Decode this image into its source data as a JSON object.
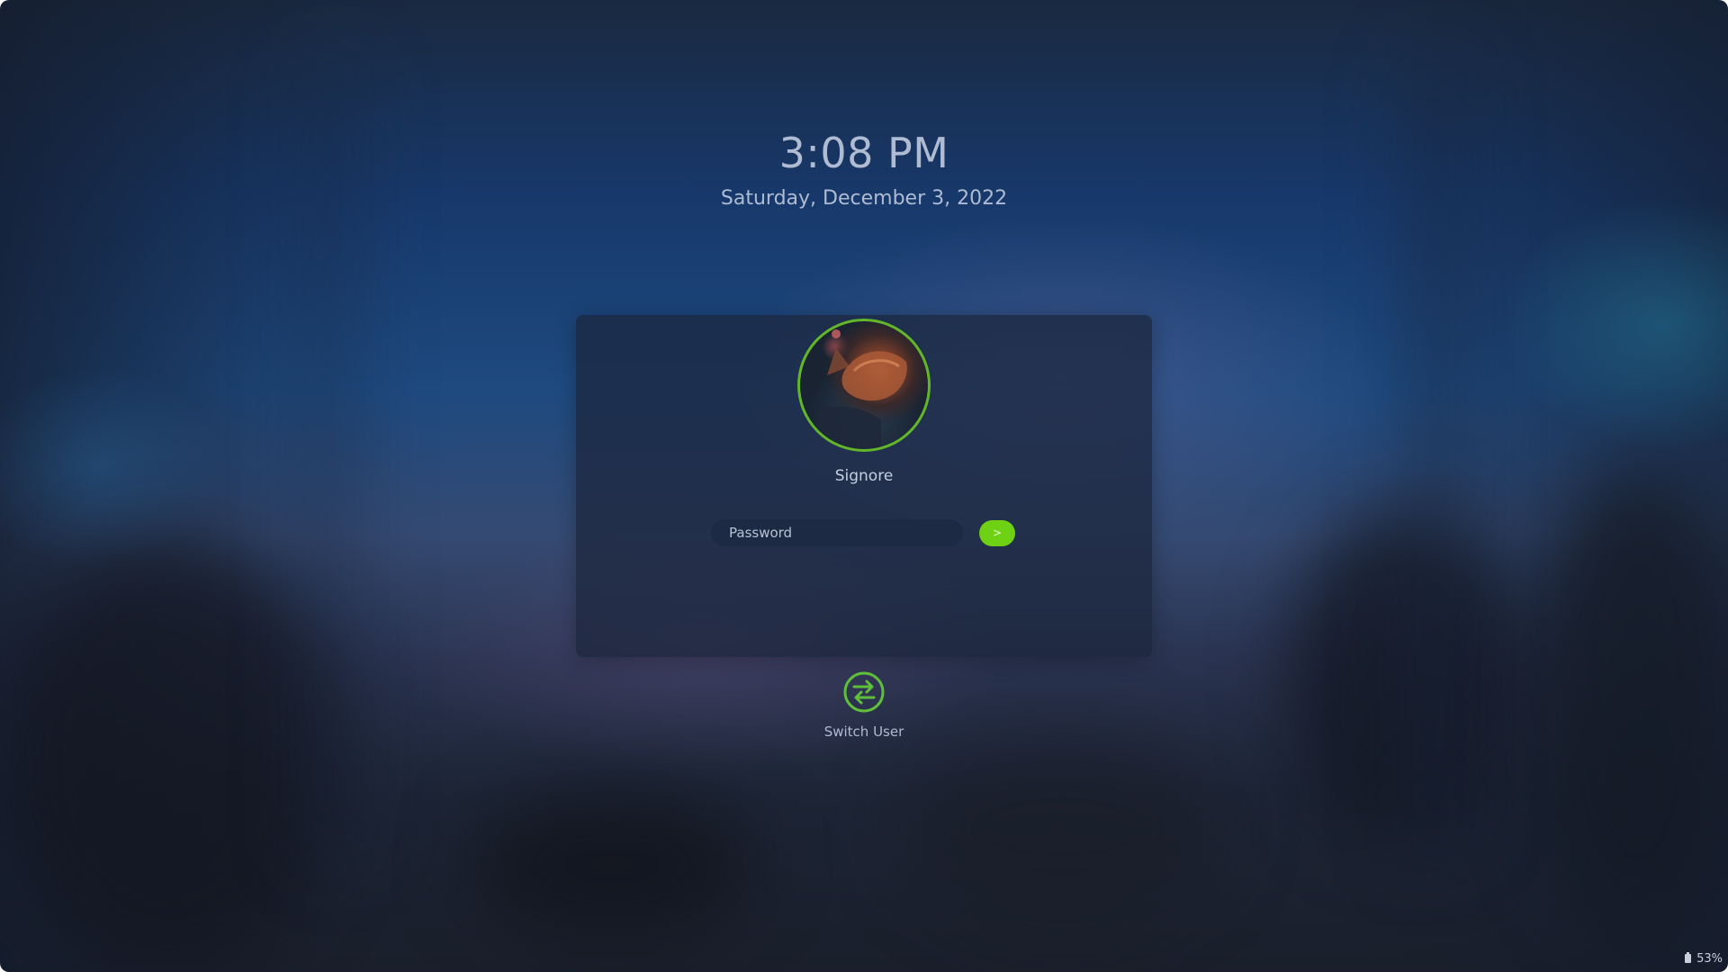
{
  "clock": {
    "time": "3:08 PM",
    "date": "Saturday, December 3, 2022"
  },
  "user": {
    "name": "Signore",
    "avatar_icon": "cat-avatar-photo"
  },
  "login": {
    "password_placeholder": "Password",
    "password_value": "",
    "submit_label": ">"
  },
  "switch_user": {
    "label": "Switch User",
    "icon": "switch-arrows-icon"
  },
  "status": {
    "battery_percent": "53%",
    "battery_icon": "battery-icon"
  },
  "colors": {
    "accent": "#6fd114",
    "ring": "#63b62a",
    "text": "#aebbd2"
  }
}
